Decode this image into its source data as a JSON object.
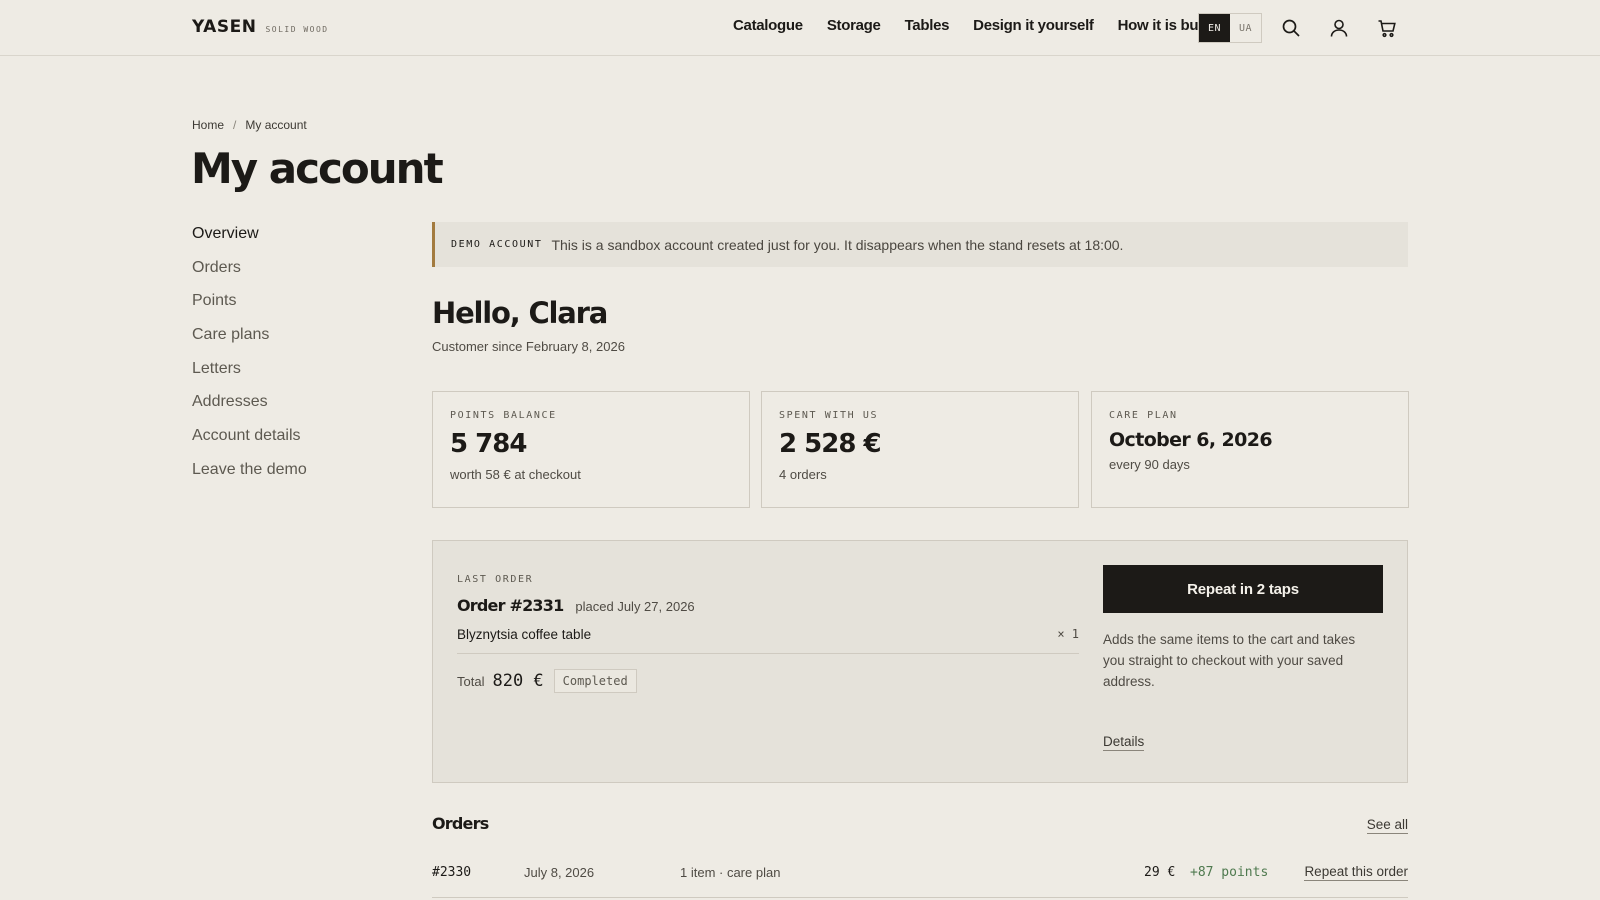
{
  "brand": {
    "name": "YASEN",
    "tagline": "SOLID WOOD"
  },
  "nav": {
    "items": [
      "Catalogue",
      "Storage",
      "Tables",
      "Design it yourself",
      "How it is built"
    ],
    "languages": [
      "EN",
      "UA"
    ],
    "active_language": "EN",
    "icons": [
      "search-icon",
      "account-icon",
      "cart-icon"
    ]
  },
  "breadcrumb": {
    "home": "Home",
    "separator": "/",
    "current": "My account"
  },
  "page_title": "My account",
  "sidebar": {
    "items": [
      "Overview",
      "Orders",
      "Points",
      "Care plans",
      "Letters",
      "Addresses",
      "Account details",
      "Leave the demo"
    ],
    "active": "Overview"
  },
  "demo_banner": {
    "tag": "DEMO ACCOUNT",
    "text": "This is a sandbox account created just for you. It disappears when the stand resets at 18:00.",
    "accent_color": "#a37b3f"
  },
  "greeting": {
    "hello": "Hello, Clara",
    "since": "Customer since February 8, 2026"
  },
  "stats": {
    "points": {
      "label": "POINTS BALANCE",
      "value": "5 784",
      "sub": "worth 58 € at checkout"
    },
    "spent": {
      "label": "SPENT WITH US",
      "value": "2 528 €",
      "sub": "4 orders"
    },
    "care": {
      "label": "CARE PLAN",
      "value": "October 6, 2026",
      "sub": "every 90 days"
    }
  },
  "last_order": {
    "label": "LAST ORDER",
    "number": "Order #2331",
    "placed": "placed July 27, 2026",
    "item_name": "Blyznytsia coffee table",
    "item_qty": "× 1",
    "total_label": "Total",
    "total_value": "820 €",
    "status": "Completed",
    "repeat_button": "Repeat in 2 taps",
    "repeat_note": "Adds the same items to the cart and takes you straight to checkout with your saved address.",
    "details_link": "Details"
  },
  "orders": {
    "title": "Orders",
    "see_all": "See all",
    "rows": [
      {
        "id": "#2330",
        "date": "July 8, 2026",
        "desc": "1 item · care plan",
        "amount": "29 €",
        "points": "+87 points",
        "action": "Repeat this order"
      }
    ]
  },
  "colors": {
    "background": "#eeebe4",
    "dark": "#1c1a17",
    "points_green": "#4f7a4f"
  }
}
